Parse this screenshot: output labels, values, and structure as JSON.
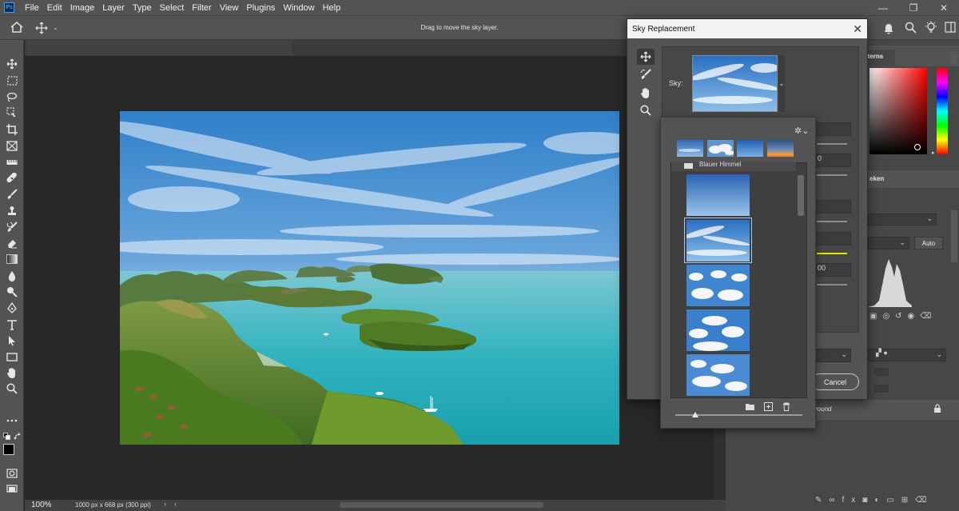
{
  "app": {
    "logo": "Ps"
  },
  "menu": [
    "File",
    "Edit",
    "Image",
    "Layer",
    "Type",
    "Select",
    "Filter",
    "View",
    "Plugins",
    "Window",
    "Help"
  ],
  "window_controls": {
    "minimize": "—",
    "restore": "❐",
    "close": "✕"
  },
  "options_bar": {
    "hint": "Drag to move the sky layer."
  },
  "status_bar": {
    "zoom": "100%",
    "doc_info": "1000 px x 668 px (300 ppi)"
  },
  "dialog": {
    "title": "Sky Replacement",
    "sky_label": "Sky:",
    "cancel_label": "Cancel",
    "tools": [
      "move-sky-icon",
      "sky-brush-icon",
      "hand-icon",
      "zoom-icon"
    ]
  },
  "sky_picker": {
    "group_label": "Blauer Himmel",
    "preset_count": 4,
    "list_items": 5,
    "selected_index": 1,
    "slider_value": 0.12
  },
  "right_panel": {
    "tab_patterns": "tterns",
    "tab_second": "eken",
    "auto_button": "Auto",
    "layer_name": "round",
    "field_value_1": "0",
    "field_value_2": "00"
  },
  "colors": {
    "accent": "#31a8ff",
    "selection_border": "#9ecbff",
    "yellow_line": "#e6e600"
  }
}
